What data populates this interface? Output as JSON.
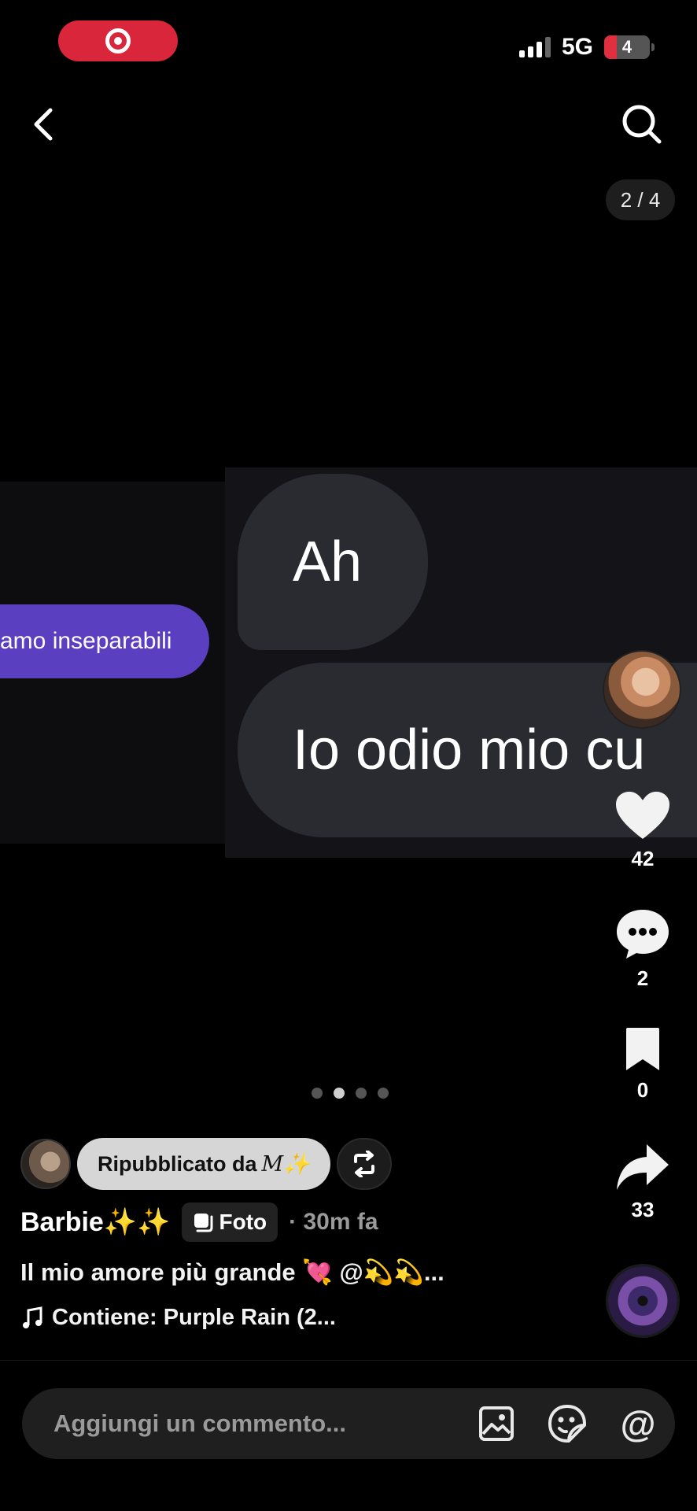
{
  "status_bar": {
    "network": "5G",
    "battery": "4"
  },
  "header": {
    "page_indicator": "2 / 4"
  },
  "media": {
    "left_bubble_text": "amo inseparabili",
    "bubble_1": "Ah",
    "bubble_2": "Io odio mio cu"
  },
  "actions": {
    "likes": "42",
    "comments": "2",
    "saves": "0",
    "shares": "33"
  },
  "carousel": {
    "total": 4,
    "active": 2
  },
  "post": {
    "repost_label": "Ripubblicato da",
    "repost_user": "𝑀✨",
    "author": "Barbie✨✨",
    "type_label": "Foto",
    "time": "· 30m fa",
    "caption": "Il mio amore più grande 💘 @💫💫...",
    "music": "Contiene: Purple Rain (2..."
  },
  "comment_bar": {
    "placeholder": "Aggiungi un commento..."
  },
  "colors": {
    "record": "#d9263b",
    "bubble_purple": "#5a3fc0",
    "bubble_gray": "#2a2a31"
  }
}
